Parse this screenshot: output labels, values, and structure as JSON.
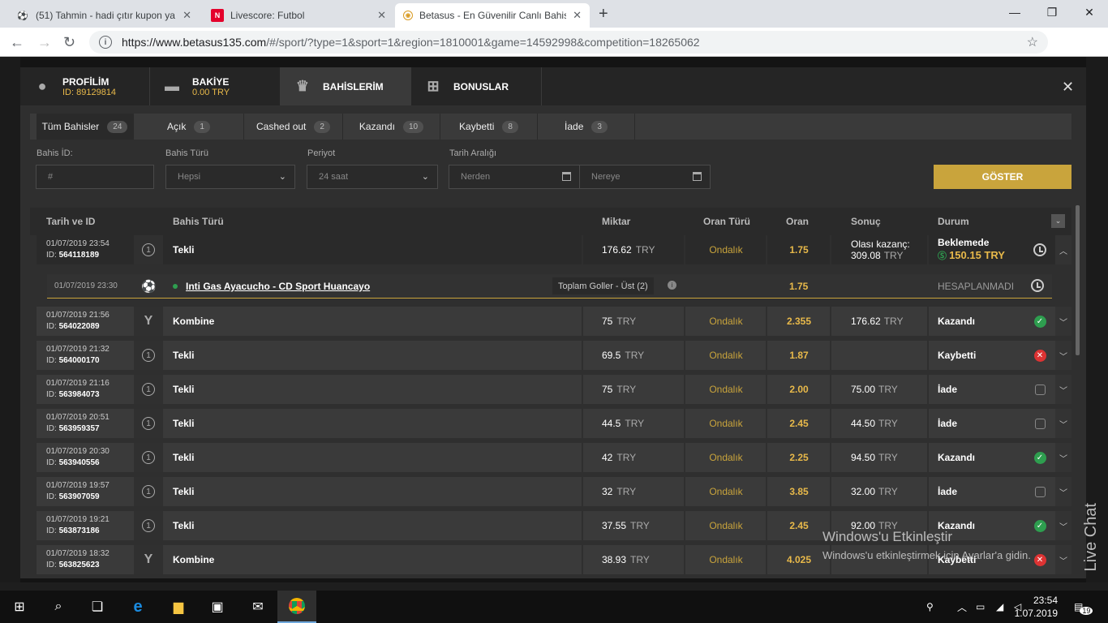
{
  "browser": {
    "tabs": [
      {
        "title": "(51) Tahmin - hadi çıtır kupon ya",
        "close": "✕"
      },
      {
        "title": "Livescore: Futbol",
        "close": "✕"
      },
      {
        "title": "Betasus - En Güvenilir Canlı Bahis",
        "close": "✕"
      }
    ],
    "new_tab": "+",
    "url_host": "https://www.betasus135.com",
    "url_path": "/#/sport/?type=1&sport=1&region=1810001&game=14592998&competition=18265062"
  },
  "modal": {
    "tabs": [
      {
        "label": "PROFİLİM",
        "sub": "ID: 89129814"
      },
      {
        "label": "BAKİYE",
        "sub": "0.00 TRY"
      },
      {
        "label": "BAHİSLERİM",
        "sub": ""
      },
      {
        "label": "BONUSLAR",
        "sub": ""
      }
    ],
    "close": "✕"
  },
  "filter_tabs": [
    {
      "label": "Tüm Bahisler",
      "count": "24"
    },
    {
      "label": "Açık",
      "count": "1"
    },
    {
      "label": "Cashed out",
      "count": "2"
    },
    {
      "label": "Kazandı",
      "count": "10"
    },
    {
      "label": "Kaybetti",
      "count": "8"
    },
    {
      "label": "İade",
      "count": "3"
    }
  ],
  "filters": {
    "bet_id_label": "Bahis İD:",
    "bet_id_placeholder": "#",
    "bet_type_label": "Bahis Türü",
    "bet_type_value": "Hepsi",
    "period_label": "Periyot",
    "period_value": "24 saat",
    "date_range_label": "Tarih Aralığı",
    "from_placeholder": "Nerden",
    "to_placeholder": "Nereye",
    "show_button": "GÖSTER"
  },
  "table": {
    "headers": [
      "Tarih ve ID",
      "Bahis Türü",
      "Miktar",
      "Oran Türü",
      "Oran",
      "Sonuç",
      "Durum"
    ],
    "rows": [
      {
        "date": "01/07/2019 23:54",
        "id": "564118189",
        "icon": "1",
        "type": "Tekli",
        "amount": "176.62",
        "currency": "TRY",
        "odds_type": "Ondalık",
        "odds": "1.75",
        "result_label": "Olası kazanç:",
        "result": "309.08",
        "status": "Beklemede",
        "status_extra": "150.15 TRY"
      },
      {
        "date": "01/07/2019 21:56",
        "id": "564022089",
        "icon": "Y",
        "type": "Kombine",
        "amount": "75",
        "currency": "TRY",
        "odds_type": "Ondalık",
        "odds": "2.355",
        "result": "176.62",
        "status": "Kazandı"
      },
      {
        "date": "01/07/2019 21:32",
        "id": "564000170",
        "icon": "1",
        "type": "Tekli",
        "amount": "69.5",
        "currency": "TRY",
        "odds_type": "Ondalık",
        "odds": "1.87",
        "result": "",
        "status": "Kaybetti"
      },
      {
        "date": "01/07/2019 21:16",
        "id": "563984073",
        "icon": "1",
        "type": "Tekli",
        "amount": "75",
        "currency": "TRY",
        "odds_type": "Ondalık",
        "odds": "2.00",
        "result": "75.00",
        "status": "İade"
      },
      {
        "date": "01/07/2019 20:51",
        "id": "563959357",
        "icon": "1",
        "type": "Tekli",
        "amount": "44.5",
        "currency": "TRY",
        "odds_type": "Ondalık",
        "odds": "2.45",
        "result": "44.50",
        "status": "İade"
      },
      {
        "date": "01/07/2019 20:30",
        "id": "563940556",
        "icon": "1",
        "type": "Tekli",
        "amount": "42",
        "currency": "TRY",
        "odds_type": "Ondalık",
        "odds": "2.25",
        "result": "94.50",
        "status": "Kazandı"
      },
      {
        "date": "01/07/2019 19:57",
        "id": "563907059",
        "icon": "1",
        "type": "Tekli",
        "amount": "32",
        "currency": "TRY",
        "odds_type": "Ondalık",
        "odds": "3.85",
        "result": "32.00",
        "status": "İade"
      },
      {
        "date": "01/07/2019 19:21",
        "id": "563873186",
        "icon": "1",
        "type": "Tekli",
        "amount": "37.55",
        "currency": "TRY",
        "odds_type": "Ondalık",
        "odds": "2.45",
        "result": "92.00",
        "status": "Kazandı"
      },
      {
        "date": "01/07/2019 18:32",
        "id": "563825623",
        "icon": "Y",
        "type": "Kombine",
        "amount": "38.93",
        "currency": "TRY",
        "odds_type": "Ondalık",
        "odds": "4.025",
        "result": "",
        "status": "Kaybetti"
      }
    ],
    "event": {
      "date": "01/07/2019 23:30",
      "match": "Inti Gas Ayacucho - CD Sport Huancayo",
      "market": "Toplam Goller - Üst (2)",
      "odds": "1.75",
      "status": "HESAPLANMADI"
    }
  },
  "watermark": {
    "title": "Windows'u Etkinleştir",
    "sub": "Windows'u etkinleştirmek için Ayarlar'a gidin."
  },
  "live_chat": "Live Chat",
  "taskbar": {
    "time": "23:54",
    "date": "1.07.2019",
    "badge": "19"
  },
  "colors": {
    "accent": "#c9a43c",
    "win": "#2e9e4f",
    "lose": "#dd3333"
  }
}
